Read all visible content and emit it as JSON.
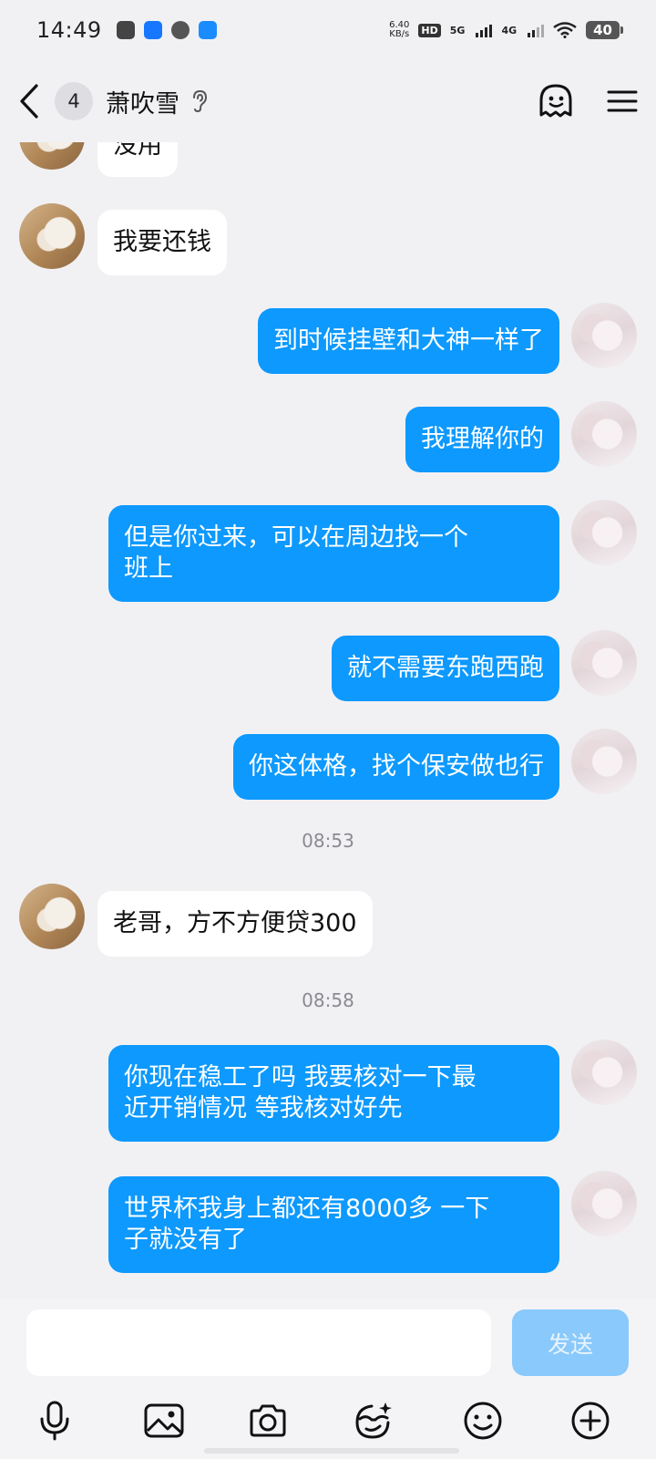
{
  "status_bar": {
    "time": "14:49",
    "net_speed_value": "6.40",
    "net_speed_unit": "KB/s",
    "hd_label": "HD",
    "sim1_tech": "5G",
    "sim2_tech": "4G",
    "battery": "40"
  },
  "header": {
    "unread_count": "4",
    "contact_name": "萧吹雪"
  },
  "messages": [
    {
      "text": "没用"
    },
    {
      "text": "我要还钱"
    },
    {
      "text": "到时候挂壁和大神一样了"
    },
    {
      "text": "我理解你的"
    },
    {
      "text": "但是你过来，可以在周边找一个\n班上"
    },
    {
      "text": "就不需要东跑西跑"
    },
    {
      "text": "你这体格，找个保安做也行"
    },
    {
      "text": "老哥，方不方便贷300"
    },
    {
      "text": "你现在稳工了吗 我要核对一下最\n近开销情况 等我核对好先"
    },
    {
      "text": "世界杯我身上都还有8000多 一下\n子就没有了"
    }
  ],
  "timestamps": [
    "08:53",
    "08:58"
  ],
  "input": {
    "value": "",
    "placeholder": "",
    "send_label": "发送"
  },
  "colors": {
    "outgoing_bubble": "#0d99fd",
    "incoming_bubble": "#ffffff",
    "send_button_disabled": "#89c9fb",
    "background": "#f1f1f4"
  },
  "icons": [
    "back-icon",
    "ear-icon",
    "face-icon",
    "menu-icon",
    "microphone-icon",
    "image-icon",
    "camera-icon",
    "sticker-icon",
    "emoji-icon",
    "plus-icon"
  ]
}
